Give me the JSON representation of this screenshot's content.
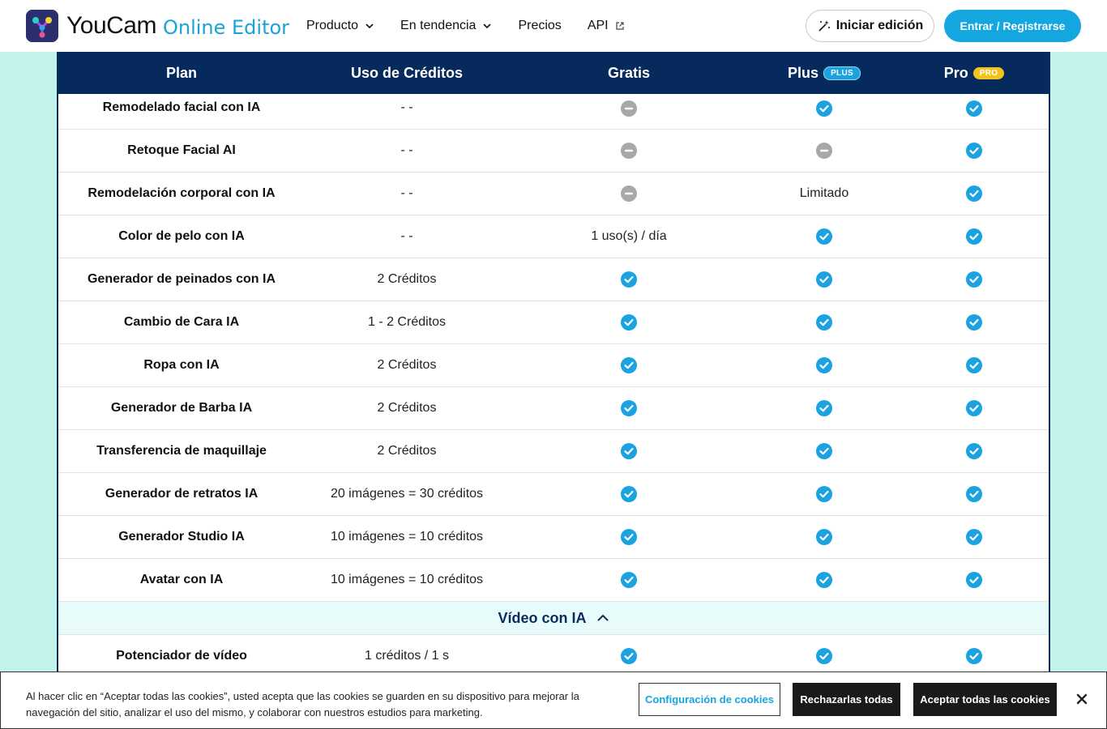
{
  "header": {
    "brand": "YouCam",
    "brand_sub": "Online Editor",
    "nav": [
      {
        "label": "Producto",
        "has_dropdown": true
      },
      {
        "label": "En tendencia",
        "has_dropdown": true
      },
      {
        "label": "Precios",
        "has_dropdown": false
      },
      {
        "label": "API",
        "external": true
      }
    ],
    "edit_button": "Iniciar edición",
    "login_button": "Entrar / Registrarse"
  },
  "table": {
    "headers": {
      "plan": "Plan",
      "uso": "Uso de Créditos",
      "gratis": "Gratis",
      "plus": "Plus",
      "plus_badge": "PLUS",
      "pro": "Pro",
      "pro_badge": "PRO"
    },
    "rows": [
      {
        "name": "Remodelado facial con IA",
        "uso": "- -",
        "gratis": "no",
        "plus": "yes",
        "pro": "yes"
      },
      {
        "name": "Retoque Facial AI",
        "uso": "- -",
        "gratis": "no",
        "plus": "no",
        "pro": "yes"
      },
      {
        "name": "Remodelación corporal con IA",
        "uso": "- -",
        "gratis": "no",
        "plus": "Limitado",
        "pro": "yes"
      },
      {
        "name": "Color de pelo con IA",
        "uso": "- -",
        "gratis": "1 uso(s) / día",
        "plus": "yes",
        "pro": "yes"
      },
      {
        "name": "Generador de peinados con IA",
        "uso": "2 Créditos",
        "gratis": "yes",
        "plus": "yes",
        "pro": "yes"
      },
      {
        "name": "Cambio de Cara IA",
        "uso": "1 - 2 Créditos",
        "gratis": "yes",
        "plus": "yes",
        "pro": "yes"
      },
      {
        "name": "Ropa con IA",
        "uso": "2 Créditos",
        "gratis": "yes",
        "plus": "yes",
        "pro": "yes"
      },
      {
        "name": "Generador de Barba IA",
        "uso": "2 Créditos",
        "gratis": "yes",
        "plus": "yes",
        "pro": "yes"
      },
      {
        "name": "Transferencia de maquillaje",
        "uso": "2 Créditos",
        "gratis": "yes",
        "plus": "yes",
        "pro": "yes"
      },
      {
        "name": "Generador de retratos IA",
        "uso": "20 imágenes = 30 créditos",
        "gratis": "yes",
        "plus": "yes",
        "pro": "yes"
      },
      {
        "name": "Generador Studio IA",
        "uso": "10 imágenes = 10 créditos",
        "gratis": "yes",
        "plus": "yes",
        "pro": "yes"
      },
      {
        "name": "Avatar con IA",
        "uso": "10 imágenes = 10 créditos",
        "gratis": "yes",
        "plus": "yes",
        "pro": "yes"
      }
    ],
    "section": {
      "label": "Vídeo con IA",
      "expanded": true
    },
    "section_rows": [
      {
        "name": "Potenciador de vídeo",
        "uso": "1 créditos / 1 s",
        "gratis": "yes",
        "plus": "yes",
        "pro": "yes"
      }
    ]
  },
  "cookie": {
    "text": "Al hacer clic en “Aceptar todas las cookies”, usted acepta que las cookies se guarden en su dispositivo para mejorar la navegación del sitio, analizar el uso del mismo, y colaborar con nuestros estudios para marketing.",
    "config_button": "Configuración de cookies",
    "reject_button": "Rechazarlas todas",
    "accept_button": "Aceptar todas las cookies"
  },
  "colors": {
    "accent": "#14a6de",
    "header_navy": "#062a5c",
    "check": "#1aa3e0",
    "unavailable": "#a8a8a8",
    "page_bg": "#c2f4ec"
  }
}
